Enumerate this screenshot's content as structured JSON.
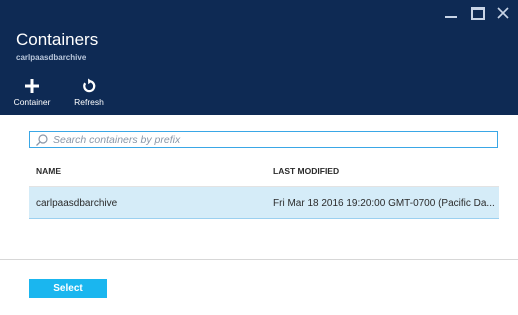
{
  "header": {
    "title": "Containers",
    "subtitle": "carlpaasdbarchive",
    "commands": [
      {
        "label": "Container",
        "icon": "plus-icon"
      },
      {
        "label": "Refresh",
        "icon": "refresh-icon"
      }
    ]
  },
  "search": {
    "placeholder": "Search containers by prefix",
    "value": ""
  },
  "table": {
    "columns": [
      "NAME",
      "LAST MODIFIED"
    ],
    "rows": [
      {
        "name": "carlpaasdbarchive",
        "last_modified": "Fri Mar 18 2016 19:20:00 GMT-0700 (Pacific Da..."
      }
    ]
  },
  "footer": {
    "select_label": "Select"
  },
  "colors": {
    "header_bg": "#0e2a54",
    "accent": "#1ab6ef",
    "selected_row": "#d5ecf8"
  }
}
